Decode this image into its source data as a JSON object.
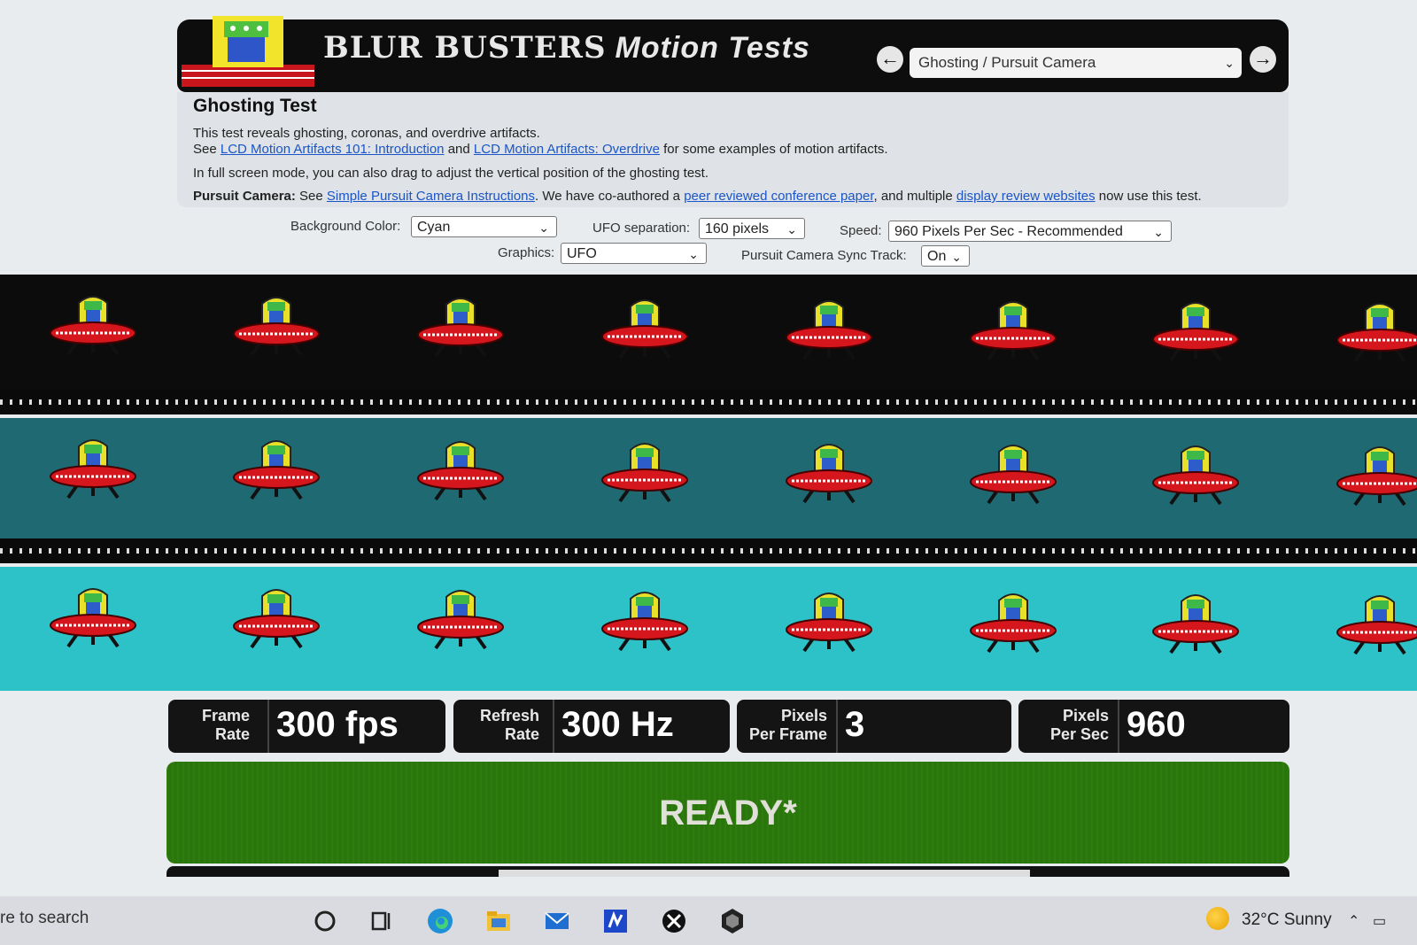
{
  "header": {
    "brand": "BLUR BUSTERS",
    "brand_sub": "Motion Tests",
    "test_select": "Ghosting / Pursuit Camera"
  },
  "info": {
    "title": "Ghosting Test",
    "line1": "This test reveals ghosting, coronas, and overdrive artifacts.",
    "line2_see": "See",
    "line2_link1": "LCD Motion Artifacts 101: Introduction",
    "line2_and": "and",
    "line2_link2": "LCD Motion Artifacts: Overdrive",
    "line2_rest": "for some examples of motion artifacts.",
    "line3": "In full screen mode, you can also drag to adjust the vertical position of the ghosting test.",
    "line4_label": "Pursuit Camera:",
    "line4_see": "See",
    "line4_link1": "Simple Pursuit Camera Instructions",
    "line4_mid": ". We have co-authored a",
    "line4_link2": "peer reviewed conference paper",
    "line4_mid2": ", and multiple",
    "line4_link3": "display review websites",
    "line4_end": "now use this test."
  },
  "controls": {
    "bg_label": "Background Color:",
    "bg_value": "Cyan",
    "sep_label": "UFO separation:",
    "sep_value": "160 pixels",
    "speed_label": "Speed:",
    "speed_value": "960 Pixels Per Sec - Recommended",
    "graphics_label": "Graphics:",
    "graphics_value": "UFO",
    "sync_label": "Pursuit Camera Sync Track:",
    "sync_value": "On"
  },
  "tracks": [
    {
      "color": "#0c0c0c"
    },
    {
      "color": "#1f6a72"
    },
    {
      "color": "#2cc2c8"
    }
  ],
  "readouts": {
    "frame_rate_label_1": "Frame",
    "frame_rate_label_2": "Rate",
    "frame_rate_value": "300 fps",
    "refresh_label_1": "Refresh",
    "refresh_label_2": "Rate",
    "refresh_value": "300 Hz",
    "ppf_label_1": "Pixels",
    "ppf_label_2": "Per Frame",
    "ppf_value": "3",
    "pps_label_1": "Pixels",
    "pps_label_2": "Per Sec",
    "pps_value": "960"
  },
  "status": "READY*",
  "taskbar": {
    "search_text": "re to search",
    "weather": "32°C  Sunny"
  }
}
